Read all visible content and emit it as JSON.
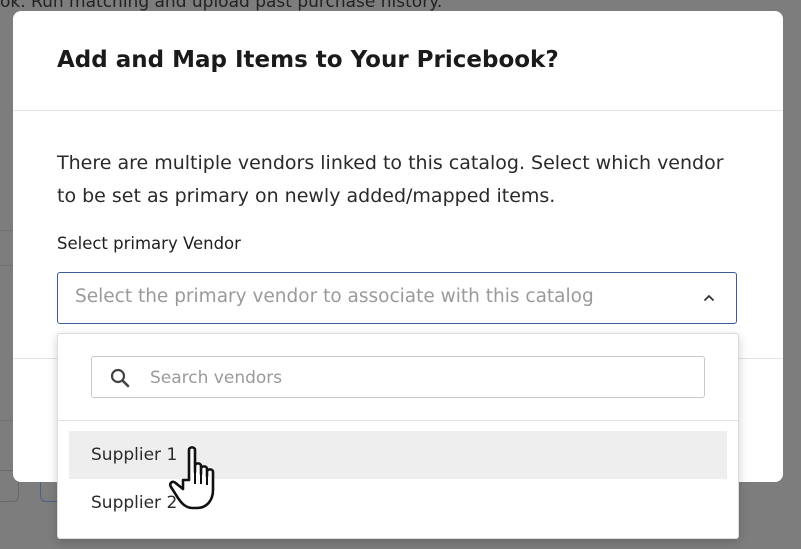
{
  "background": {
    "partial_text": "ok. Run matching and upload past purchase history."
  },
  "modal": {
    "title": "Add and Map Items to Your Pricebook?",
    "description": "There are multiple vendors linked to this catalog. Select which vendor to be set as primary on newly added/mapped items.",
    "field_label": "Select primary Vendor",
    "select_placeholder": "Select the primary vendor to associate with this catalog"
  },
  "dropdown": {
    "search_placeholder": "Search vendors",
    "options": [
      {
        "label": "Supplier 1",
        "hovered": true
      },
      {
        "label": "Supplier 2",
        "hovered": false
      }
    ]
  },
  "icons": {
    "search": "search-icon",
    "chevron": "chevron-up-icon",
    "cursor": "hand-pointer-cursor-icon"
  },
  "colors": {
    "select_border": "#3d5a99",
    "hover_background": "#eeeeee",
    "overlay": "#7f7f7f"
  }
}
